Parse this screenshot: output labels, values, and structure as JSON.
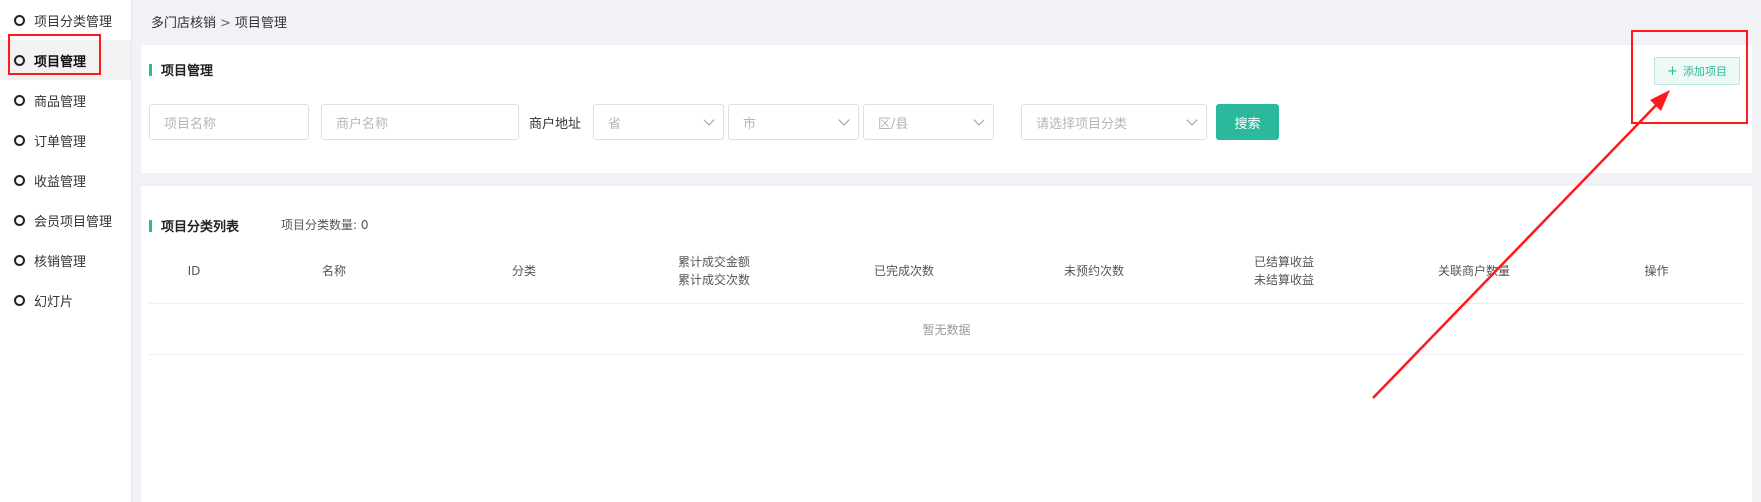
{
  "sidebar": {
    "items": [
      {
        "label": "项目分类管理",
        "active": false
      },
      {
        "label": "项目管理",
        "active": true
      },
      {
        "label": "商品管理",
        "active": false
      },
      {
        "label": "订单管理",
        "active": false
      },
      {
        "label": "收益管理",
        "active": false
      },
      {
        "label": "会员项目管理",
        "active": false
      },
      {
        "label": "核销管理",
        "active": false
      },
      {
        "label": "幻灯片",
        "active": false
      }
    ]
  },
  "breadcrumb": {
    "parent": "多门店核销",
    "separator": ">",
    "current": "项目管理"
  },
  "filter_panel": {
    "title": "项目管理",
    "add_button": {
      "icon": "plus-icon",
      "label": "添加项目"
    },
    "project_name_placeholder": "项目名称",
    "merchant_name_placeholder": "商户名称",
    "address_label": "商户地址",
    "province_placeholder": "省",
    "city_placeholder": "市",
    "district_placeholder": "区/县",
    "category_placeholder": "请选择项目分类",
    "search_label": "搜索"
  },
  "list_panel": {
    "title": "项目分类列表",
    "count_label": "项目分类数量:",
    "count_value": "0",
    "columns": [
      {
        "line1": "ID",
        "line2": ""
      },
      {
        "line1": "名称",
        "line2": ""
      },
      {
        "line1": "分类",
        "line2": ""
      },
      {
        "line1": "累计成交金额",
        "line2": "累计成交次数"
      },
      {
        "line1": "已完成次数",
        "line2": ""
      },
      {
        "line1": "未预约次数",
        "line2": ""
      },
      {
        "line1": "已结算收益",
        "line2": "未结算收益"
      },
      {
        "line1": "关联商户数量",
        "line2": ""
      },
      {
        "line1": "操作",
        "line2": ""
      }
    ],
    "empty_text": "暂无数据"
  },
  "colors": {
    "accent": "#2bb89b",
    "annotation": "#ff1a1a"
  }
}
